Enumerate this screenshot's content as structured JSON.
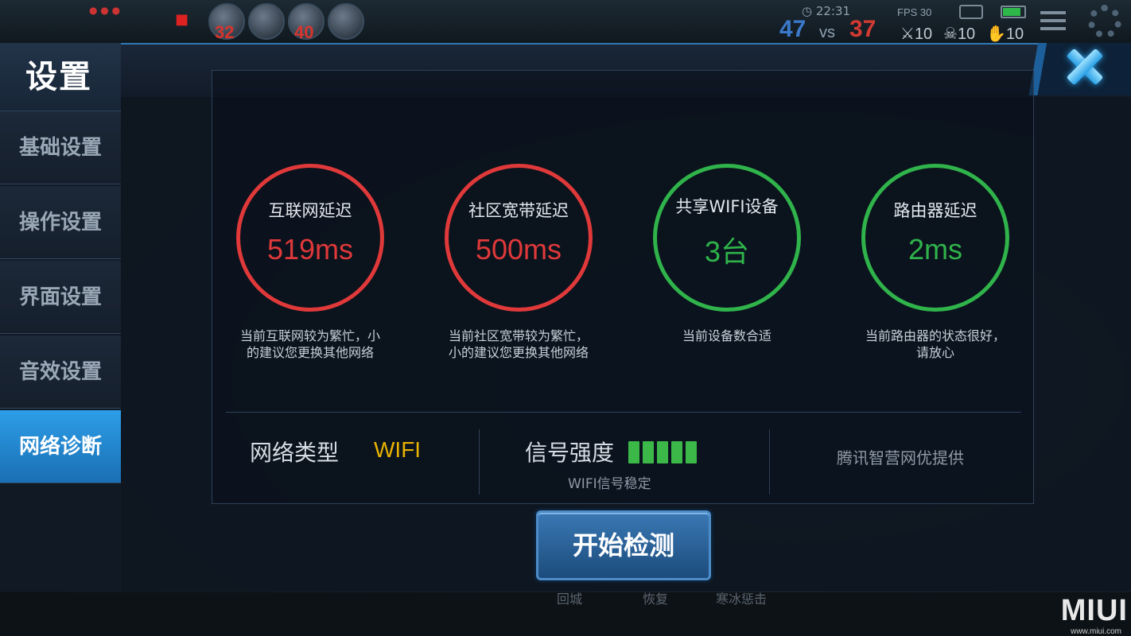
{
  "hud": {
    "heroes": [
      {
        "level": "32"
      },
      {
        "level": ""
      },
      {
        "level": "40"
      },
      {
        "level": ""
      }
    ],
    "time": "22:31",
    "fps": "FPS 30",
    "score_blue": "47",
    "vs": "vs",
    "score_red": "37",
    "kills": "10",
    "deaths": "10",
    "assists": "10"
  },
  "sidebar": {
    "title": "设置",
    "items": [
      {
        "label": "基础设置",
        "active": false
      },
      {
        "label": "操作设置",
        "active": false
      },
      {
        "label": "界面设置",
        "active": false
      },
      {
        "label": "音效设置",
        "active": false
      },
      {
        "label": "网络诊断",
        "active": true
      }
    ]
  },
  "metrics": [
    {
      "title": "互联网延迟",
      "value": "519ms",
      "status_color": "#e0393a",
      "desc_line1": "当前互联网较为繁忙，小",
      "desc_line2": "的建议您更换其他网络"
    },
    {
      "title": "社区宽带延迟",
      "value": "500ms",
      "status_color": "#e0393a",
      "desc_line1": "当前社区宽带较为繁忙，",
      "desc_line2": "小的建议您更换其他网络"
    },
    {
      "title": "共享WIFI设备",
      "value": "3台",
      "status_color": "#2fb34a",
      "desc_line1": "当前设备数合适",
      "desc_line2": ""
    },
    {
      "title": "路由器延迟",
      "value": "2ms",
      "status_color": "#2fb34a",
      "desc_line1": "当前路由器的状态很好，",
      "desc_line2": "请放心"
    }
  ],
  "network": {
    "type_label": "网络类型",
    "type_value": "WIFI",
    "type_color": "#e9b200",
    "signal_label": "信号强度",
    "signal_bars_filled": 5,
    "signal_bars_total": 5,
    "signal_status": "WIFI信号稳定",
    "provider": "腾讯智营网优提供"
  },
  "actions": {
    "start_label": "开始检测"
  },
  "bottom": {
    "skills": [
      "回城",
      "恢复",
      "寒冰惩击"
    ],
    "watermark": "MIUI",
    "watermark_url": "www.miui.com"
  },
  "icons": {
    "close": "close-icon",
    "settings": "gear-icon",
    "menu": "menu-icon"
  }
}
